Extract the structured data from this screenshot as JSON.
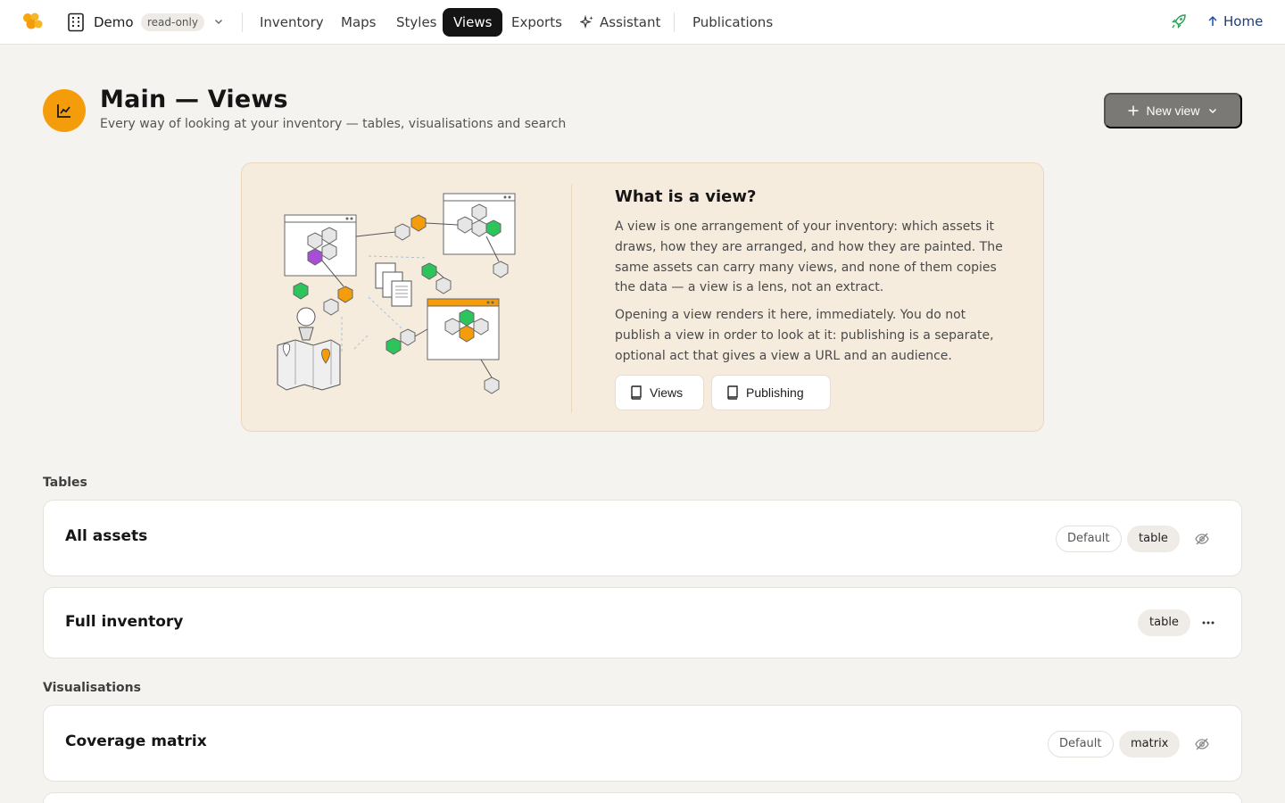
{
  "topbar": {
    "workspace_name": "Demo",
    "workspace_badge": "read-only",
    "nav": [
      {
        "label": "Inventory",
        "active": false
      },
      {
        "label": "Maps",
        "active": false
      },
      {
        "label": "Styles",
        "active": false
      },
      {
        "label": "Views",
        "active": true
      },
      {
        "label": "Exports",
        "active": false
      },
      {
        "label": "Assistant",
        "active": false
      },
      {
        "label": "Publications",
        "active": false
      }
    ],
    "home_label": "Home"
  },
  "page": {
    "title": "Main — Views",
    "subtitle": "Every way of looking at your inventory — tables, visualisations and search",
    "new_view_label": "New view"
  },
  "info": {
    "heading": "What is a view?",
    "p1": "A view is one arrangement of your inventory: which assets it draws, how they are arranged, and how they are painted. The same assets can carry many views, and none of them copies the data — a view is a lens, not an extract.",
    "p2": "Opening a view renders it here, immediately. You do not publish a view in order to look at it: publishing is a separate, optional act that gives a view a URL and an audience.",
    "btn_views": "Views",
    "btn_publishing": "Publishing"
  },
  "sections": {
    "tables": {
      "label": "Tables",
      "rows": [
        {
          "title": "All assets",
          "badges": [
            "Default",
            "table"
          ],
          "action_icon": "eye-off-icon"
        },
        {
          "title": "Full inventory",
          "badges": [
            "table"
          ],
          "action_icon": "more-icon"
        }
      ]
    },
    "visualisations": {
      "label": "Visualisations",
      "rows": [
        {
          "title": "Coverage matrix",
          "badges": [
            "Default",
            "matrix"
          ],
          "action_icon": "eye-off-icon"
        }
      ]
    }
  },
  "colors": {
    "accent_orange": "#f59c0b",
    "active_nav": "#141414",
    "info_card_bg": "#f6ecde",
    "page_bg": "#f5f3ef"
  }
}
